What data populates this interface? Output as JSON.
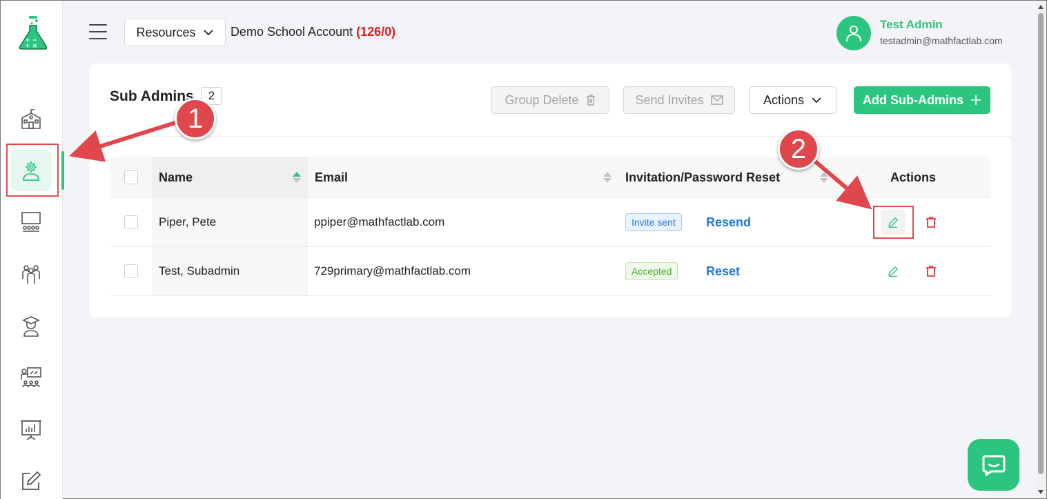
{
  "header": {
    "resources_label": "Resources",
    "account_name": "Demo School Account",
    "account_count": "(126/0)",
    "user_name": "Test Admin",
    "user_email": "testadmin@mathfactlab.com"
  },
  "sidebar": {
    "items": [
      {
        "name": "school",
        "icon": "school-icon"
      },
      {
        "name": "sub-admins",
        "icon": "admin-gear-icon",
        "active": true
      },
      {
        "name": "classrooms",
        "icon": "classroom-icon"
      },
      {
        "name": "groups",
        "icon": "people-group-icon"
      },
      {
        "name": "students",
        "icon": "graduate-icon"
      },
      {
        "name": "teachers",
        "icon": "teacher-icon"
      },
      {
        "name": "reports",
        "icon": "presentation-chart-icon"
      },
      {
        "name": "assignments",
        "icon": "edit-icon"
      }
    ]
  },
  "card": {
    "title": "Sub Admins",
    "count": "2",
    "group_delete_label": "Group Delete",
    "send_invites_label": "Send Invites",
    "actions_label": "Actions",
    "add_label": "Add Sub-Admins"
  },
  "table": {
    "columns": {
      "name": "Name",
      "email": "Email",
      "invitation": "Invitation/Password Reset",
      "actions": "Actions"
    },
    "rows": [
      {
        "name": "Piper, Pete",
        "email": "ppiper@mathfactlab.com",
        "status": "Invite sent",
        "status_type": "blue",
        "action_link": "Resend"
      },
      {
        "name": "Test, Subadmin",
        "email": "729primary@mathfactlab.com",
        "status": "Accepted",
        "status_type": "green",
        "action_link": "Reset"
      }
    ]
  },
  "annotations": {
    "step1": "1",
    "step2": "2"
  },
  "colors": {
    "brand_green": "#2cc57f",
    "link_blue": "#1f7ae0",
    "danger_red": "#e5191d",
    "annotation_red": "#e0474c"
  }
}
